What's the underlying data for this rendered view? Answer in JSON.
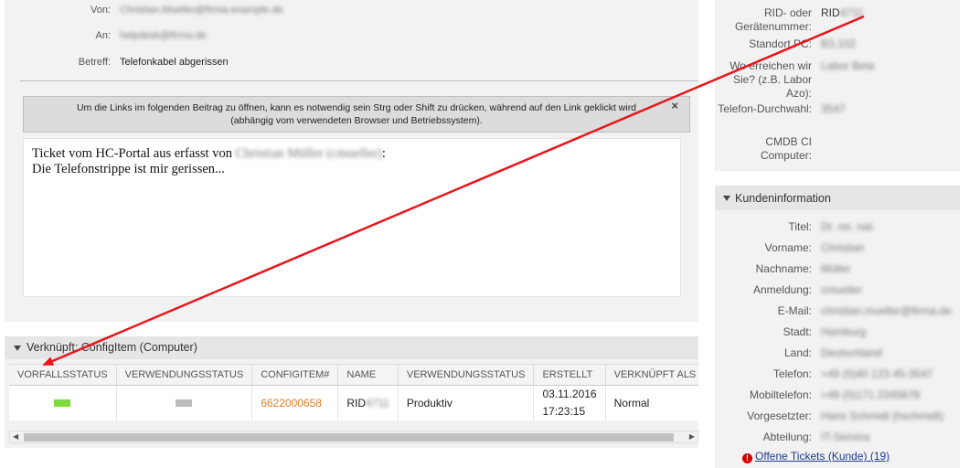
{
  "article": {
    "from_label": "Von:",
    "from_value": "Christian.Mueller@firma-example.de",
    "to_label": "An:",
    "to_value": "helpdesk@firma.de",
    "subject_label": "Betreff:",
    "subject_value": "Telefonkabel abgerissen",
    "notice_line1": "Um die Links im folgenden Beitrag zu öffnen, kann es notwendig sein Strg oder Shift zu drücken, während auf den Link geklickt wird",
    "notice_line2": "(abhängig vom verwendeten Browser und Betriebssystem).",
    "notice_close": "×",
    "body_line1_prefix": "Ticket vom HC-Portal aus erfasst von ",
    "body_line1_name": "Christian Müller (cmueller)",
    "body_line1_suffix": ":",
    "body_line2": "Die Telefonstrippe ist mir gerissen..."
  },
  "linked": {
    "title": "Verknüpft: ConfigItem (Computer)",
    "columns": [
      "VORFALLSSTATUS",
      "VERWENDUNGSSTATUS",
      "CONFIGITEM#",
      "NAME",
      "VERWENDUNGSSTATUS",
      "ERSTELLT",
      "VERKNÜPFT ALS"
    ],
    "row": {
      "configitem_number": "6622000658",
      "name_prefix": "RID",
      "name_hidden": "4711",
      "usage_state": "Produktiv",
      "created_date": "03.11.2016",
      "created_time": "17:23:15",
      "link_type": "Normal"
    },
    "status_colors": {
      "incident": "#7fda3e",
      "usage": "#bcbcbc"
    }
  },
  "ticket_fields": {
    "items": [
      {
        "label": "RID- oder Gerätenummer:",
        "value_prefix": "RID",
        "value_hidden": "4711"
      },
      {
        "label": "Standort PC:",
        "value": "B3.102"
      },
      {
        "label": "Wo erreichen wir Sie? (z.B. Labor Azo):",
        "value": "Labor Beta"
      },
      {
        "label": "Telefon-Durchwahl:",
        "value": "3547"
      },
      {
        "label": "CMDB CI Computer:",
        "value": ""
      }
    ]
  },
  "customer": {
    "title": "Kundeninformation",
    "fields": [
      {
        "label": "Titel:",
        "value": "Dr. rer. nat."
      },
      {
        "label": "Vorname:",
        "value": "Christian"
      },
      {
        "label": "Nachname:",
        "value": "Müller"
      },
      {
        "label": "Anmeldung:",
        "value": "cmueller"
      },
      {
        "label": "E-Mail:",
        "value": "christian.mueller@firma.de"
      },
      {
        "label": "Stadt:",
        "value": "Hamburg"
      },
      {
        "label": "Land:",
        "value": "Deutschland"
      },
      {
        "label": "Telefon:",
        "value": "+49 (0)40 123 45-3547"
      },
      {
        "label": "Mobiltelefon:",
        "value": "+49 (0)171 2345678"
      },
      {
        "label": "Vorgesetzter:",
        "value": "Hans Schmidt (hschmidt)"
      },
      {
        "label": "Abteilung:",
        "value": "IT-Service"
      }
    ],
    "open_tickets_icon": "!",
    "open_tickets_label": "Offene Tickets (Kunde) (19)"
  },
  "annotation": {
    "arrow_color": "#e8161b",
    "arrow_icon": "red-annotation-arrow"
  }
}
